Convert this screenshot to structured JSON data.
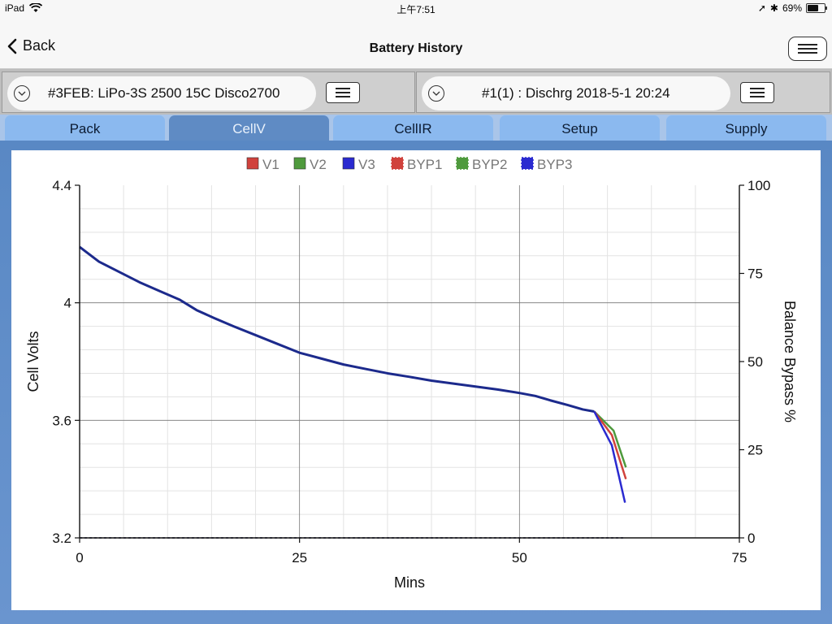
{
  "status": {
    "device": "iPad",
    "time": "上午7:51",
    "battery": "69%"
  },
  "nav": {
    "back_label": "Back",
    "title": "Battery History"
  },
  "selectors": {
    "pack": "#3FEB: LiPo-3S 2500 15C Disco2700",
    "log": "#1(1) : Dischrg 2018-5-1 20:24"
  },
  "tabs": [
    {
      "label": "Pack",
      "active": false
    },
    {
      "label": "CellV",
      "active": true
    },
    {
      "label": "CellIR",
      "active": false
    },
    {
      "label": "Setup",
      "active": false
    },
    {
      "label": "Supply",
      "active": false
    }
  ],
  "colors": {
    "v1": "#d0423c",
    "v2": "#4f9a3d",
    "v3": "#2a2ad0",
    "line_main": "#1c2a8c",
    "accent_tab": "#5f8bc4"
  },
  "chart_data": {
    "type": "line",
    "xlabel": "Mins",
    "ylabel": "Cell Volts",
    "y2label": "Balance Bypass %",
    "xlim": [
      0,
      75
    ],
    "ylim": [
      3.2,
      4.4
    ],
    "y2lim": [
      0,
      100
    ],
    "xticks": [
      "0",
      "25",
      "50",
      "75"
    ],
    "yticks": [
      "3.2",
      "3.6",
      "4",
      "4.4"
    ],
    "y2ticks": [
      "0",
      "25",
      "50",
      "75",
      "100"
    ],
    "grid": true,
    "legend_position": "top",
    "legend": [
      "V1",
      "V2",
      "V3",
      "BYP1",
      "BYP2",
      "BYP3"
    ],
    "shared": {
      "x": [
        0,
        2.2,
        4.5,
        6.8,
        9.1,
        11.4,
        13.3,
        15.3,
        17.5,
        20,
        22.5,
        25,
        27.5,
        30,
        32.5,
        35,
        37.5,
        40,
        42.5,
        45,
        47.5,
        50,
        51.8,
        53.5,
        55.5,
        57.2,
        58.5
      ],
      "y": [
        4.19,
        4.14,
        4.105,
        4.07,
        4.04,
        4.01,
        3.975,
        3.948,
        3.92,
        3.89,
        3.86,
        3.83,
        3.81,
        3.79,
        3.775,
        3.76,
        3.748,
        3.735,
        3.725,
        3.715,
        3.705,
        3.693,
        3.683,
        3.668,
        3.652,
        3.637,
        3.63
      ]
    },
    "series": [
      {
        "name": "V1",
        "x": [
          58.5,
          60.5,
          62.1
        ],
        "y": [
          3.63,
          3.55,
          3.4
        ]
      },
      {
        "name": "V2",
        "x": [
          58.5,
          60.7,
          62.1
        ],
        "y": [
          3.63,
          3.565,
          3.44
        ]
      },
      {
        "name": "V3",
        "x": [
          58.5,
          60.5,
          62.0
        ],
        "y": [
          3.63,
          3.515,
          3.32
        ]
      },
      {
        "name": "BYP1",
        "x": [
          0,
          62
        ],
        "y": [
          0,
          0
        ]
      },
      {
        "name": "BYP2",
        "x": [
          0,
          62
        ],
        "y": [
          0,
          0
        ]
      },
      {
        "name": "BYP3",
        "x": [
          0,
          62
        ],
        "y": [
          0,
          0
        ]
      }
    ]
  }
}
